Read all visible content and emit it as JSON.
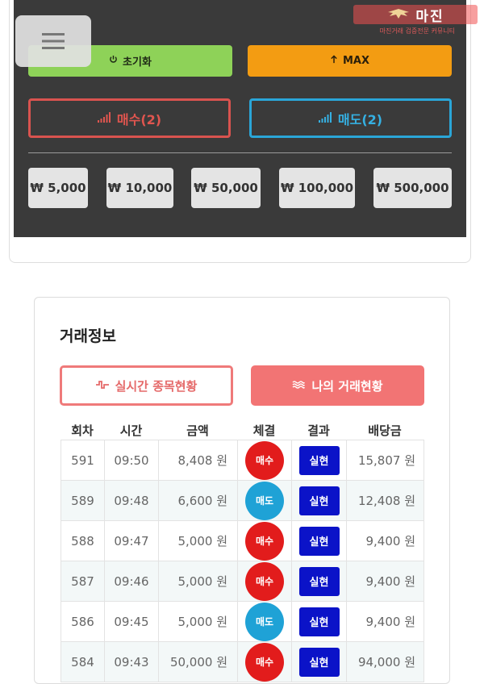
{
  "logo": {
    "main": "마진",
    "sub": "마진거래 검증전문 커뮤니티"
  },
  "controls": {
    "reset_label": "초기화",
    "max_label": "MAX",
    "buy_label": "매수(2)",
    "sell_label": "매도(2)",
    "amounts": [
      "₩ 5,000",
      "₩ 10,000",
      "₩ 50,000",
      "₩ 100,000",
      "₩ 500,000"
    ]
  },
  "trade_info": {
    "title": "거래정보",
    "tab_live": "실시간 종목현황",
    "tab_mine": "나의 거래현황",
    "headers": [
      "회차",
      "시간",
      "금액",
      "체결",
      "결과",
      "배당금"
    ],
    "rows": [
      {
        "round": "591",
        "time": "09:50",
        "amount": "8,408 원",
        "side": "매수",
        "result": "실현",
        "payout": "15,807 원"
      },
      {
        "round": "589",
        "time": "09:48",
        "amount": "6,600 원",
        "side": "매도",
        "result": "실현",
        "payout": "12,408 원"
      },
      {
        "round": "588",
        "time": "09:47",
        "amount": "5,000 원",
        "side": "매수",
        "result": "실현",
        "payout": "9,400 원"
      },
      {
        "round": "587",
        "time": "09:46",
        "amount": "5,000 원",
        "side": "매수",
        "result": "실현",
        "payout": "9,400 원"
      },
      {
        "round": "586",
        "time": "09:45",
        "amount": "5,000 원",
        "side": "매도",
        "result": "실현",
        "payout": "9,400 원"
      },
      {
        "round": "584",
        "time": "09:43",
        "amount": "50,000 원",
        "side": "매수",
        "result": "실현",
        "payout": "94,000 원"
      }
    ]
  },
  "colors": {
    "buy": "#e21c1c",
    "sell": "#1fa2d6",
    "result": "#0b13c8",
    "accent": "#f27474"
  }
}
